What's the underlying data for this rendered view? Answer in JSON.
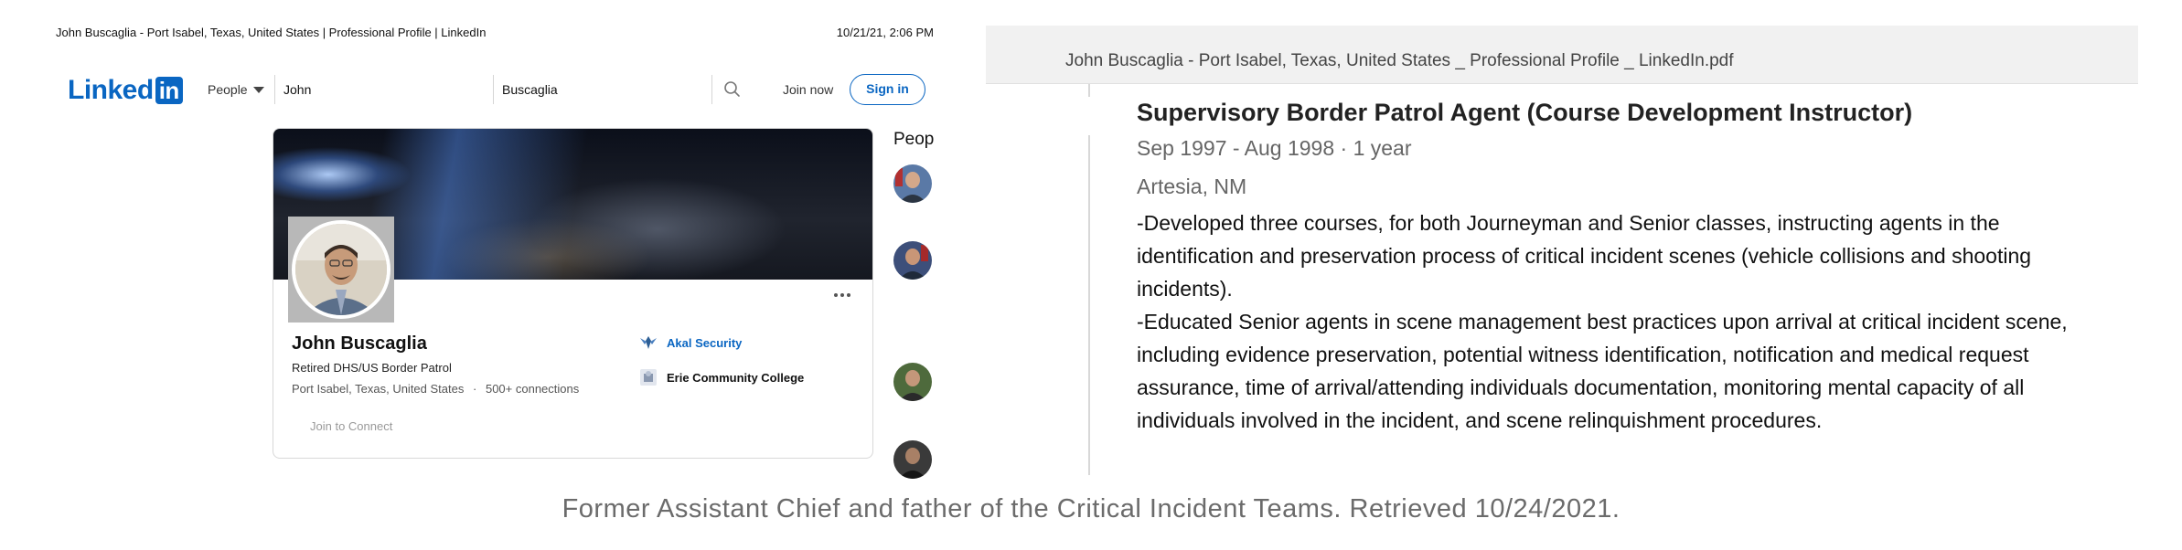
{
  "print_header": {
    "page_title": "John Buscaglia - Port Isabel, Texas, United States | Professional Profile | LinkedIn",
    "timestamp": "10/21/21, 2:06 PM"
  },
  "nav": {
    "logo_text": "Linked",
    "logo_in": "in",
    "people_dropdown": "People",
    "first_name_value": "John",
    "last_name_value": "Buscaglia",
    "join_now": "Join now",
    "sign_in": "Sign in"
  },
  "profile": {
    "name": "John Buscaglia",
    "headline": "Retired DHS/US Border Patrol",
    "location": "Port Isabel, Texas, United States",
    "separator": "·",
    "connections": "500+ connections",
    "current_company": "Akal Security",
    "education": "Erie Community College",
    "join_to_connect": "Join to Connect"
  },
  "sidebar": {
    "people_also_viewed": "Peop"
  },
  "pdf": {
    "filename": "John Buscaglia - Port Isabel, Texas, United States _ Professional Profile _ LinkedIn.pdf",
    "job_title": "Supervisory Border Patrol Agent (Course Development Instructor)",
    "dates": "Sep 1997 - Aug 1998 · 1 year",
    "location": "Artesia, NM",
    "description_1": "-Developed three courses, for both Journeyman and Senior classes, instructing agents in the identification and preservation process of critical incident scenes (vehicle collisions and shooting incidents).",
    "description_2": "-Educated Senior agents in scene management best practices upon arrival at critical incident scene, including evidence preservation, potential witness identification, notification and medical request assurance, time of arrival/attending individuals documentation, monitoring mental capacity of all individuals involved in the incident, and scene relinquishment procedures."
  },
  "caption": "Former Assistant Chief and father of the Critical Incident Teams. Retrieved 10/24/2021.",
  "colors": {
    "linkedin_blue": "#0a66c2",
    "pdf_toolbar": "#f1f1f1",
    "caption_gray": "#6b6b6b"
  },
  "icons": [
    "search-icon",
    "chevron-down-icon",
    "more-dots-icon",
    "akal-security-logo-icon",
    "school-logo-icon"
  ]
}
